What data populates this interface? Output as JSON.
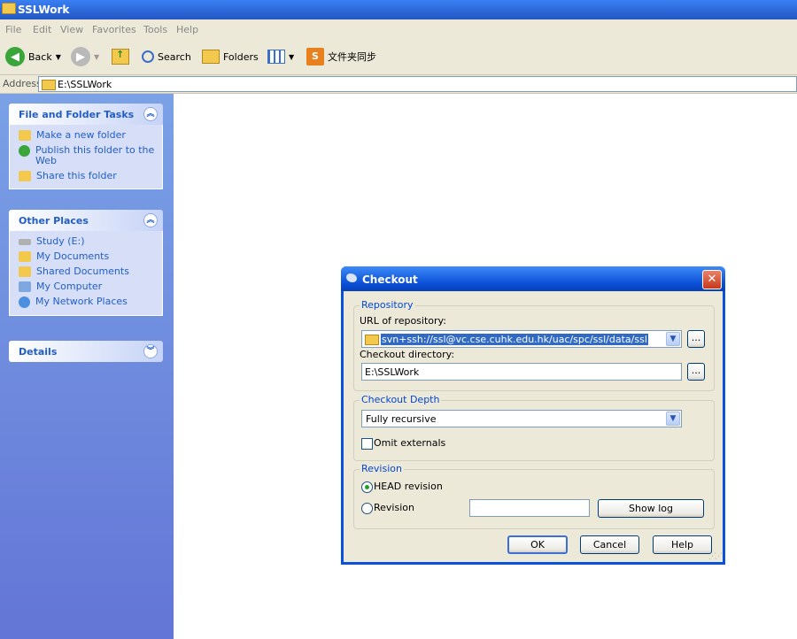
{
  "window": {
    "title": "SSLWork"
  },
  "menu": [
    "File",
    "Edit",
    "View",
    "Favorites",
    "Tools",
    "Help"
  ],
  "toolbar": {
    "back": "Back",
    "search": "Search",
    "folders": "Folders",
    "sync": "文件夹同步"
  },
  "address": {
    "label": "Address",
    "path": "E:\\SSLWork"
  },
  "sidebar": {
    "tasks": {
      "title": "File and Folder Tasks",
      "items": [
        "Make a new folder",
        "Publish this folder to the Web",
        "Share this folder"
      ]
    },
    "places": {
      "title": "Other Places",
      "items": [
        "Study (E:)",
        "My Documents",
        "Shared Documents",
        "My Computer",
        "My Network Places"
      ]
    },
    "details": {
      "title": "Details"
    }
  },
  "dialog": {
    "title": "Checkout",
    "repository": {
      "group": "Repository",
      "url_label": "URL of repository:",
      "url_value": "svn+ssh://ssl@vc.cse.cuhk.edu.hk/uac/spc/ssl/data/ssl",
      "dir_label": "Checkout directory:",
      "dir_value": "E:\\SSLWork",
      "browse": "..."
    },
    "depth": {
      "group": "Checkout Depth",
      "value": "Fully recursive",
      "omit_externals": "Omit externals",
      "omit_checked": false
    },
    "revision": {
      "group": "Revision",
      "head": "HEAD revision",
      "revision": "Revision",
      "revision_value": "",
      "show_log": "Show log",
      "selected": "head"
    },
    "buttons": {
      "ok": "OK",
      "cancel": "Cancel",
      "help": "Help"
    }
  },
  "colors": {
    "xp_blue": "#0a52d9",
    "sidebar_link": "#215dc6",
    "group_label": "#0046d5",
    "selection": "#316ac5"
  }
}
